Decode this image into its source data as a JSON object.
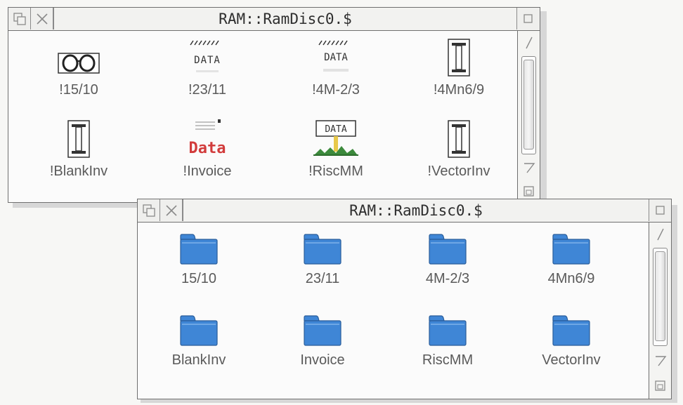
{
  "window_back": {
    "title": "RAM::RamDisc0.$",
    "items": [
      {
        "label": "!15/10",
        "icon": "glasses-icon"
      },
      {
        "label": "!23/11",
        "icon": "data-file-icon",
        "icon_text": "DATA"
      },
      {
        "label": "!4M-2/3",
        "icon": "data-file-icon",
        "icon_text": "DATA"
      },
      {
        "label": "!4Mn6/9",
        "icon": "text-cursor-icon"
      },
      {
        "label": "!BlankInv",
        "icon": "text-cursor-icon"
      },
      {
        "label": "!Invoice",
        "icon": "data-red-icon",
        "icon_text": "Data"
      },
      {
        "label": "!RiscMM",
        "icon": "data-landscape-icon",
        "icon_text": "DATA"
      },
      {
        "label": "!VectorInv",
        "icon": "text-cursor-icon"
      }
    ]
  },
  "window_front": {
    "title": "RAM::RamDisc0.$",
    "items": [
      {
        "label": "15/10",
        "icon": "folder-icon"
      },
      {
        "label": "23/11",
        "icon": "folder-icon"
      },
      {
        "label": "4M-2/3",
        "icon": "folder-icon"
      },
      {
        "label": "4Mn6/9",
        "icon": "folder-icon"
      },
      {
        "label": "BlankInv",
        "icon": "folder-icon"
      },
      {
        "label": "Invoice",
        "icon": "folder-icon"
      },
      {
        "label": "RiscMM",
        "icon": "folder-icon"
      },
      {
        "label": "VectorInv",
        "icon": "folder-icon"
      }
    ]
  },
  "colors": {
    "folder_blue": "#3f86d6",
    "data_red": "#d23c3c"
  }
}
